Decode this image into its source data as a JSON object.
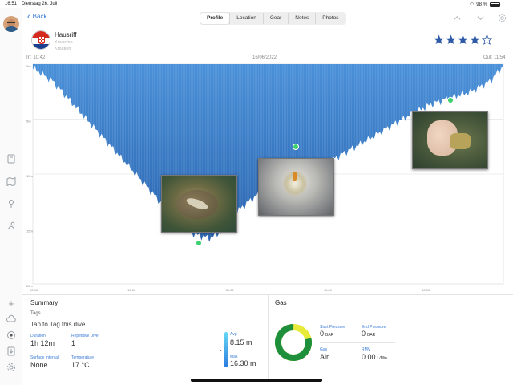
{
  "status_bar": {
    "time": "16:51",
    "date": "Dienstag 26. Juli",
    "battery": "98 %"
  },
  "nav": {
    "back_label": "Back",
    "avatar": "avatar",
    "tabs": [
      {
        "label": "Profile",
        "active": true
      },
      {
        "label": "Location",
        "active": false
      },
      {
        "label": "Gear",
        "active": false
      },
      {
        "label": "Notes",
        "active": false
      },
      {
        "label": "Photos",
        "active": false
      }
    ]
  },
  "header_icons": {
    "prev": "chevron-up-icon",
    "next": "chevron-down-icon",
    "settings": "gear-icon"
  },
  "dive_site": {
    "name": "Hausriff",
    "region": "Kovacine",
    "country": "Kroatien",
    "flag": "croatia-flag",
    "rating": 4,
    "rating_max": 5
  },
  "colors": {
    "accent": "#3a7bd5",
    "profile_fill_top": "#4a90d9",
    "profile_fill_bottom": "#2a64b0",
    "star": "#2e5aa8",
    "gas_green": "#1e8f3a",
    "gas_yellow": "#e8ea3a"
  },
  "profile": {
    "time_in": "In: 10:42",
    "date": "16/06/2022",
    "time_out": "Out: 11:54",
    "depth_ticks": [
      "0m",
      "5m",
      "10m",
      "15m",
      "20m"
    ],
    "time_ticks": [
      "00:00",
      "15:00",
      "30:00",
      "45:00",
      "60:00"
    ]
  },
  "chart_data": {
    "type": "area",
    "title": "",
    "xlabel": "",
    "ylabel": "",
    "x_unit": "minutes",
    "y_unit": "m",
    "ylim": [
      0,
      20
    ],
    "xlim": [
      0,
      72
    ],
    "y_reversed": true,
    "x": [
      0,
      3,
      6,
      9,
      12,
      15,
      18,
      21,
      23,
      25,
      27,
      29,
      31,
      34,
      37,
      40,
      43,
      46,
      49,
      52,
      55,
      58,
      61,
      64,
      67,
      70,
      72
    ],
    "y": [
      0.3,
      1.5,
      3.5,
      5.5,
      7.5,
      9.5,
      11.5,
      13.5,
      15.0,
      15.5,
      15.8,
      15.2,
      13.5,
      12.0,
      11.0,
      10.2,
      9.6,
      8.6,
      7.6,
      6.6,
      5.5,
      4.5,
      3.6,
      3.0,
      2.5,
      1.5,
      0.1
    ],
    "grid": true
  },
  "photos": [
    {
      "name": "photo-crab",
      "depth_marker": "",
      "alt": "crab"
    },
    {
      "name": "photo-fanworm",
      "depth_marker": "",
      "alt": "fan worm"
    },
    {
      "name": "photo-hand",
      "depth_marker": "",
      "alt": "hand holding rock"
    }
  ],
  "summary": {
    "title": "Summary",
    "tags_label": "Tags",
    "tags_placeholder": "Tap to Tag this dive",
    "duration_label": "Duration",
    "duration_value": "1h 12m",
    "repetitive_label": "Repetitive Dive",
    "repetitive_value": "1",
    "surface_label": "Surface Interval",
    "surface_value": "None",
    "temperature_label": "Temperature",
    "temperature_value": "17 °C",
    "avg_label": "Avg",
    "avg_value": "8.15 m",
    "max_label": "Max",
    "max_value": "16.30 m"
  },
  "gas": {
    "title": "Gas",
    "start_label": "Start Pressure",
    "start_value": "0",
    "start_unit": "BAR",
    "end_label": "End Pressure",
    "end_value": "0",
    "end_unit": "BAR",
    "gas_label": "Gas",
    "gas_value": "Air",
    "rmv_label": "RMV",
    "rmv_value": "0.00",
    "rmv_unit": "L/Min",
    "donut_green_fraction": 0.79
  },
  "sidebar_icons": [
    "logbook-icon",
    "map-icon",
    "location-pin-icon",
    "diver-icon",
    "plus-icon",
    "cloud-icon",
    "record-icon",
    "import-icon",
    "settings-icon"
  ]
}
